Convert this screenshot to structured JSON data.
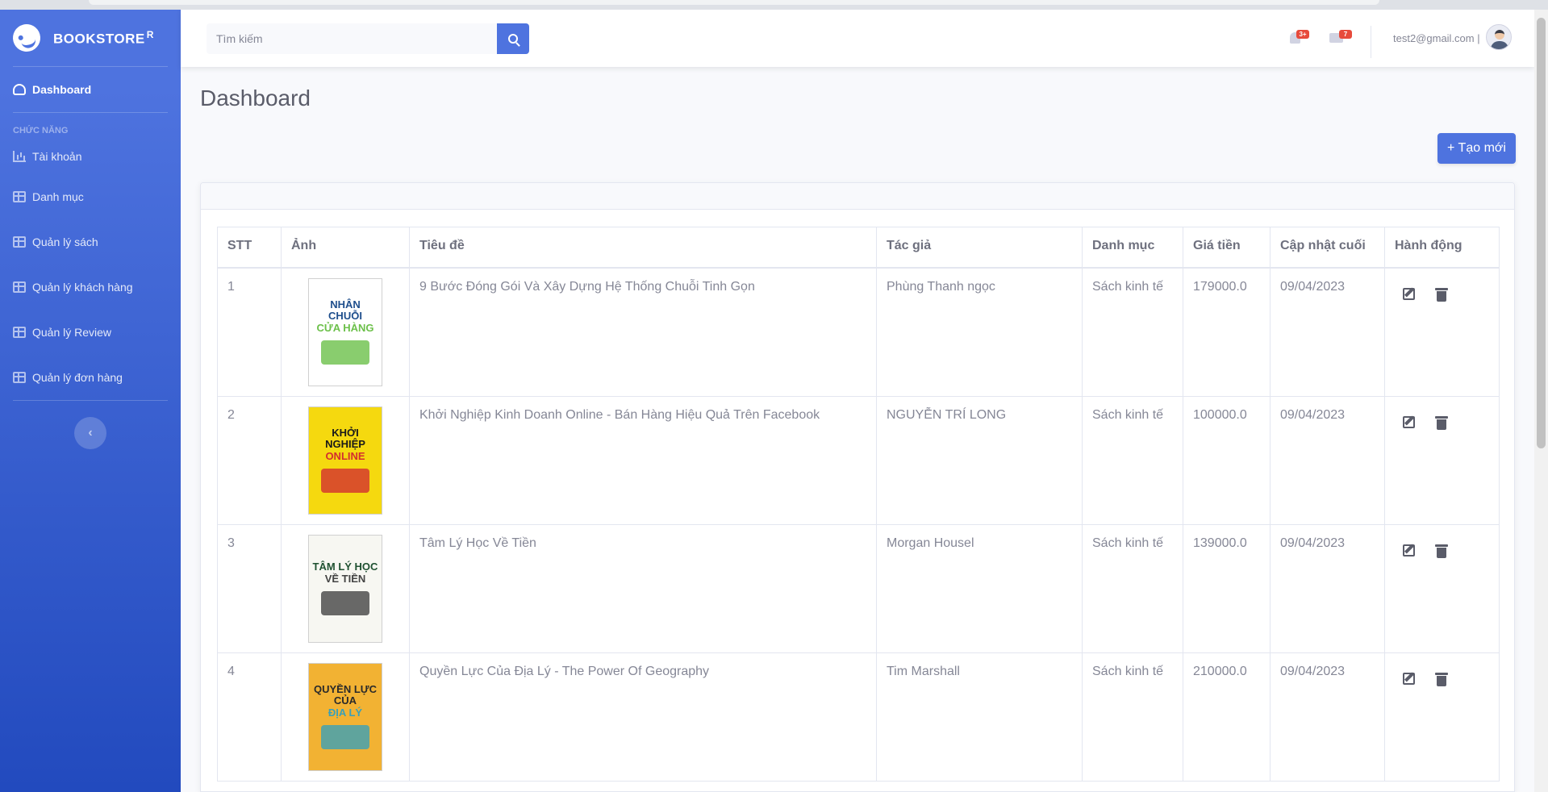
{
  "brand": {
    "name": "BOOKSTORE",
    "sup": "R"
  },
  "sidebar": {
    "dashboard": "Dashboard",
    "section": "CHỨC NĂNG",
    "items": [
      {
        "label": "Tài khoản",
        "icon": "chart-icon"
      },
      {
        "label": "Danh mục",
        "icon": "table-icon"
      },
      {
        "label": "Quản lý sách",
        "icon": "table-icon"
      },
      {
        "label": "Quản lý khách hàng",
        "icon": "table-icon"
      },
      {
        "label": "Quản lý Review",
        "icon": "table-icon"
      },
      {
        "label": "Quản lý đơn hàng",
        "icon": "table-icon"
      }
    ],
    "toggle": "‹"
  },
  "topbar": {
    "search_placeholder": "Tìm kiếm",
    "alerts_badge": "3+",
    "messages_badge": "7",
    "user_email": "test2@gmail.com |"
  },
  "main": {
    "title": "Dashboard",
    "create_label": "+ Tạo mới"
  },
  "table": {
    "headers": [
      "STT",
      "Ảnh",
      "Tiêu đề",
      "Tác giả",
      "Danh mục",
      "Giá tiền",
      "Cập nhật cuối",
      "Hành động"
    ],
    "rows": [
      {
        "stt": "1",
        "title": "9 Bước Đóng Gói Và Xây Dựng Hệ Thống Chuỗi Tinh Gọn",
        "author": "Phùng Thanh ngọc",
        "category": "Sách kinh tế",
        "price": "179000.0",
        "updated": "09/04/2023"
      },
      {
        "stt": "2",
        "title": "Khởi Nghiệp Kinh Doanh Online - Bán Hàng Hiệu Quả Trên Facebook",
        "author": "NGUYỄN TRÍ LONG",
        "category": "Sách kinh tế",
        "price": "100000.0",
        "updated": "09/04/2023"
      },
      {
        "stt": "3",
        "title": "Tâm Lý Học Về Tiền",
        "author": "Morgan Housel",
        "category": "Sách kinh tế",
        "price": "139000.0",
        "updated": "09/04/2023"
      },
      {
        "stt": "4",
        "title": "Quyền Lực Của Địa Lý - The Power Of Geography",
        "author": "Tim Marshall",
        "category": "Sách kinh tế",
        "price": "210000.0",
        "updated": "09/04/2023"
      }
    ]
  },
  "covers": [
    {
      "lines": [
        "NHÂN",
        "CHUỖI",
        "CỬA HÀNG"
      ],
      "bg": "#ffffff",
      "fg": "#1e4e8c",
      "accent": "#6cc04a"
    },
    {
      "lines": [
        "KHỞI",
        "NGHIỆP",
        "ONLINE"
      ],
      "bg": "#f5d90f",
      "fg": "#1a1a1a",
      "accent": "#d32f2f"
    },
    {
      "lines": [
        "TÂM LÝ HỌC",
        "VỀ TIỀN"
      ],
      "bg": "#f7f7f2",
      "fg": "#1f5131",
      "accent": "#444444"
    },
    {
      "lines": [
        "QUYỀN LỰC",
        "CỦA",
        "ĐỊA LÝ"
      ],
      "bg": "#f2b233",
      "fg": "#2a2a2a",
      "accent": "#3aa0b8"
    }
  ],
  "colors": {
    "primary": "#4e73df",
    "danger": "#e74a3b",
    "text": "#858796"
  }
}
